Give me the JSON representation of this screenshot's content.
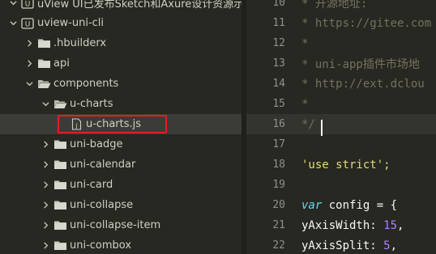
{
  "explorer": {
    "items": [
      {
        "label": "uView UI已发布Sketch和Axure设计资源示例",
        "expanded": true,
        "kind": "project"
      },
      {
        "label": "uview-uni-cli",
        "expanded": true,
        "kind": "project"
      },
      {
        "label": ".hbuilderx",
        "expanded": false,
        "kind": "folder"
      },
      {
        "label": "api",
        "expanded": false,
        "kind": "folder"
      },
      {
        "label": "components",
        "expanded": true,
        "kind": "folder"
      },
      {
        "label": "u-charts",
        "expanded": true,
        "kind": "folder"
      },
      {
        "label": "u-charts.js",
        "kind": "file",
        "selected": true
      },
      {
        "label": "uni-badge",
        "expanded": false,
        "kind": "folder"
      },
      {
        "label": "uni-calendar",
        "expanded": false,
        "kind": "folder"
      },
      {
        "label": "uni-card",
        "expanded": false,
        "kind": "folder"
      },
      {
        "label": "uni-collapse",
        "expanded": false,
        "kind": "folder"
      },
      {
        "label": "uni-collapse-item",
        "expanded": false,
        "kind": "folder"
      },
      {
        "label": "uni-combox",
        "expanded": false,
        "kind": "folder"
      }
    ]
  },
  "editor": {
    "lines": [
      {
        "num": "10",
        "text": " * 开源地址:",
        "type": "comment"
      },
      {
        "num": "11",
        "text": " * https://gitee.com",
        "type": "comment"
      },
      {
        "num": "12",
        "text": " *",
        "type": "comment"
      },
      {
        "num": "13",
        "text": " * uni-app插件市场地",
        "type": "comment"
      },
      {
        "num": "14",
        "text": " * http://ext.dclou",
        "type": "comment"
      },
      {
        "num": "15",
        "text": " *",
        "type": "comment"
      },
      {
        "num": "16",
        "text": " */",
        "type": "comment",
        "current": true
      },
      {
        "num": "17",
        "text": "",
        "type": "blank"
      },
      {
        "num": "18",
        "text": "'use strict';",
        "type": "string"
      },
      {
        "num": "19",
        "text": "",
        "type": "blank"
      },
      {
        "num": "20",
        "text": "var config = {",
        "type": "decl",
        "keyword": "var",
        "rest": " config = {"
      },
      {
        "num": "21",
        "text": "  yAxisWidth: 15,",
        "type": "prop",
        "key": "  yAxisWidth: ",
        "value": "15",
        "tail": ","
      },
      {
        "num": "22",
        "text": "  yAxisSplit: 5,",
        "type": "prop",
        "key": "  yAxisSplit: ",
        "value": "5",
        "tail": ","
      }
    ]
  },
  "colors": {
    "background": "#272822",
    "highlight_box": "#e02020",
    "comment": "#75715e",
    "string": "#e6db74",
    "keyword": "#66d9ef",
    "number": "#ae81ff"
  }
}
